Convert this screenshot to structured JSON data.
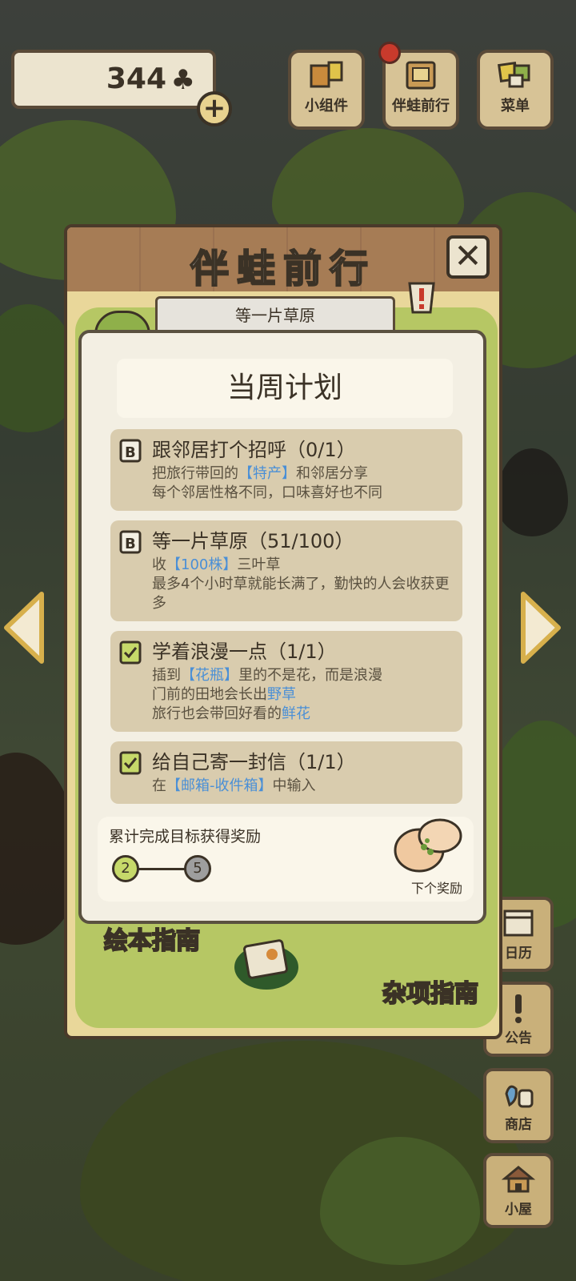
{
  "hud": {
    "clover_count": "344",
    "clover_icon": "clover-icon",
    "plus_label": "+",
    "buttons": [
      {
        "label": "小组件",
        "icon": "widget-icon"
      },
      {
        "label": "伴蛙前行",
        "icon": "journey-book-icon"
      },
      {
        "label": "菜单",
        "icon": "menu-icon"
      }
    ]
  },
  "side_menu": [
    {
      "label": "日历",
      "icon": "calendar-icon"
    },
    {
      "label": "公告",
      "icon": "notice-icon"
    },
    {
      "label": "商店",
      "icon": "shop-icon"
    },
    {
      "label": "小屋",
      "icon": "house-icon"
    }
  ],
  "panel": {
    "title": "伴蛙前行",
    "close_label": "✕",
    "banner": "等一片草原",
    "map_labels": [
      "绘本指南",
      "杂项指南"
    ]
  },
  "card": {
    "title": "当周计划",
    "tasks": [
      {
        "title": "跟邻居打个招呼（0/1）",
        "lines": [
          [
            "把旅行带回的",
            "【特产】",
            "和邻居分享"
          ],
          [
            "每个邻居性格不同，口味喜好也不同",
            "",
            ""
          ]
        ],
        "done": false
      },
      {
        "title": "等一片草原（51/100）",
        "lines": [
          [
            "收",
            "【100株】",
            "三叶草"
          ],
          [
            "最多4个小时草就能长满了，勤快的人会收获更多",
            "",
            ""
          ]
        ],
        "done": false
      },
      {
        "title": "学着浪漫一点（1/1）",
        "lines": [
          [
            "插到",
            "【花瓶】",
            "里的不是花，而是浪漫"
          ],
          [
            "门前的田地会长出",
            "野草",
            ""
          ],
          [
            "旅行也会带回好看的",
            "鲜花",
            ""
          ]
        ],
        "done": true
      },
      {
        "title": "给自己寄一封信（1/1）",
        "lines": [
          [
            "在",
            "【邮箱-收件箱】",
            "中输入"
          ]
        ],
        "done": true
      }
    ]
  },
  "reward": {
    "title": "累计完成目标获得奖励",
    "current": "2",
    "target": "5",
    "next_label": "下个奖励"
  },
  "colors": {
    "accent_green": "#c6d96a",
    "link_blue": "#4a8fd6",
    "wood": "#a67c55"
  }
}
